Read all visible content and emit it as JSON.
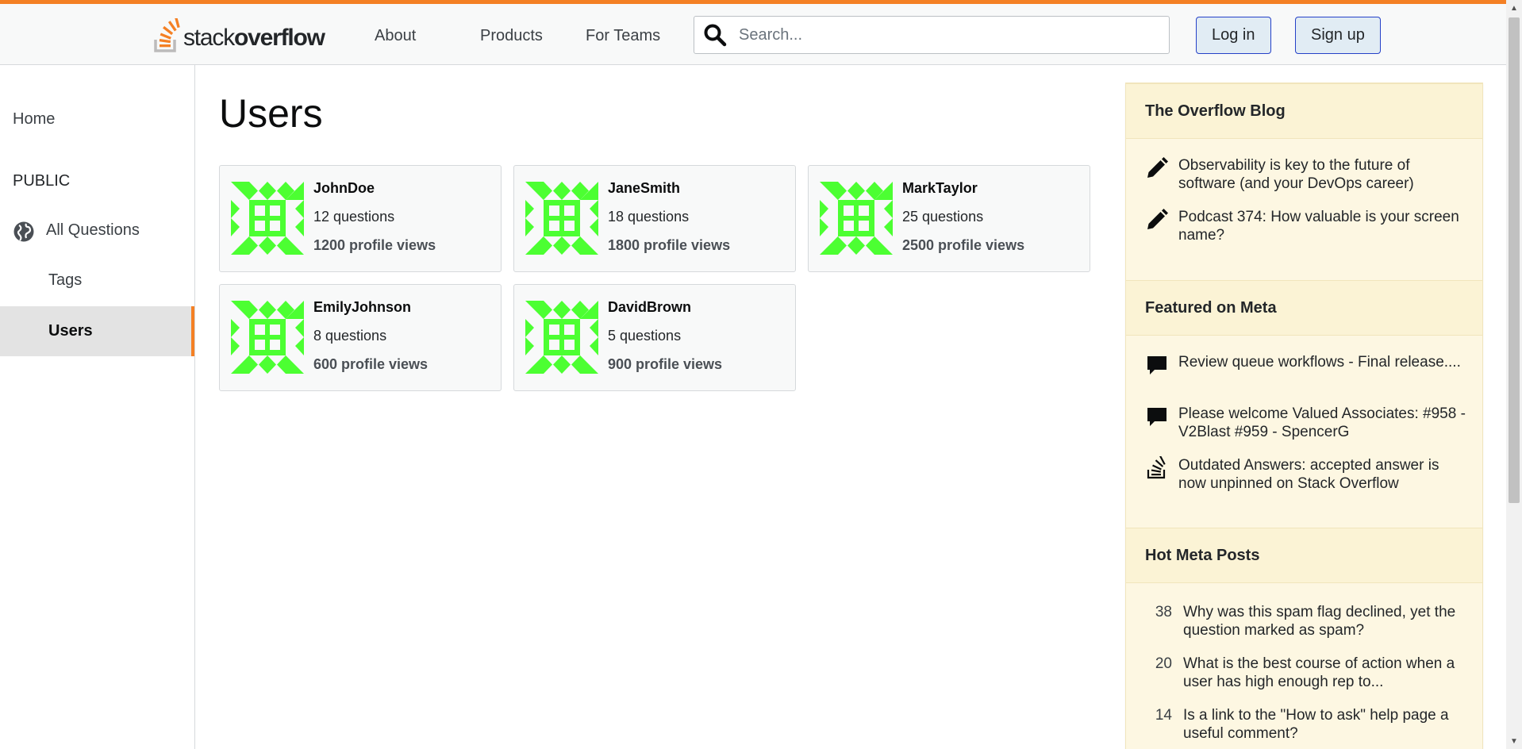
{
  "colors": {
    "accent": "#f48024",
    "avatar": "#4cff32",
    "widget_bg": "#fdf7e2",
    "button_border": "#2541c8"
  },
  "header": {
    "logo_text_light": "stack",
    "logo_text_bold": "overflow",
    "nav": [
      "About",
      "Products",
      "For Teams"
    ],
    "search_placeholder": "Search...",
    "login_label": "Log in",
    "signup_label": "Sign up"
  },
  "sidebar": {
    "home": "Home",
    "public_heading": "PUBLIC",
    "all_questions": "All Questions",
    "tags": "Tags",
    "users": "Users"
  },
  "main": {
    "title": "Users",
    "users": [
      {
        "name": "JohnDoe",
        "questions": "12 questions",
        "views": "1200 profile views"
      },
      {
        "name": "JaneSmith",
        "questions": "18 questions",
        "views": "1800 profile views"
      },
      {
        "name": "MarkTaylor",
        "questions": "25 questions",
        "views": "2500 profile views"
      },
      {
        "name": "EmilyJohnson",
        "questions": "8 questions",
        "views": "600 profile views"
      },
      {
        "name": "DavidBrown",
        "questions": "5 questions",
        "views": "900 profile views"
      }
    ]
  },
  "widget": {
    "blog_title": "The Overflow Blog",
    "blog_items": [
      {
        "icon": "pencil-icon",
        "text": "Observability is key to the future of software (and your DevOps career)"
      },
      {
        "icon": "pencil-icon",
        "text": "Podcast 374: How valuable is your screen name?"
      }
    ],
    "meta_title": "Featured on Meta",
    "meta_items": [
      {
        "icon": "comment-icon",
        "text": "Review queue workflows - Final release...."
      },
      {
        "icon": "comment-icon",
        "text": "Please welcome Valued Associates: #958 - V2Blast #959 - SpencerG"
      },
      {
        "icon": "stack-overflow-icon",
        "text": "Outdated Answers: accepted answer is now unpinned on Stack Overflow"
      }
    ],
    "hot_title": "Hot Meta Posts",
    "hot_items": [
      {
        "count": "38",
        "text": "Why was this spam flag declined, yet the question marked as spam?"
      },
      {
        "count": "20",
        "text": "What is the best course of action when a user has high enough rep to..."
      },
      {
        "count": "14",
        "text": "Is a link to the \"How to ask\" help page a useful comment?"
      }
    ]
  }
}
